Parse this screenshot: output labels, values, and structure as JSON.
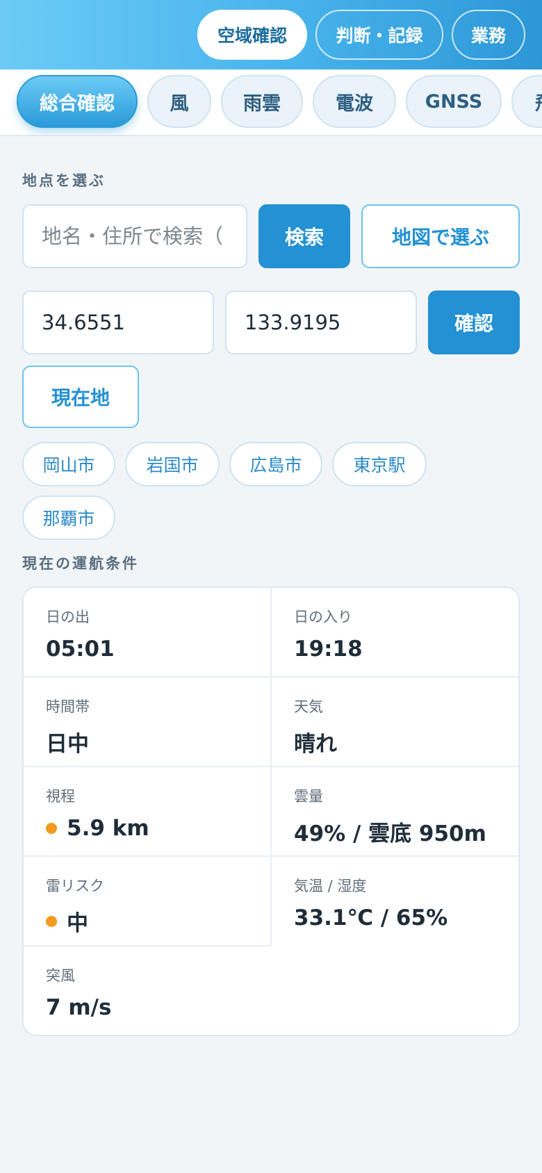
{
  "header": {
    "tabs": [
      {
        "label": "空域確認",
        "active": true
      },
      {
        "label": "判断・記録",
        "active": false
      },
      {
        "label": "業務",
        "active": false
      }
    ]
  },
  "subtabs": [
    {
      "label": "総合確認",
      "active": true
    },
    {
      "label": "風",
      "active": false
    },
    {
      "label": "雨雲",
      "active": false
    },
    {
      "label": "電波",
      "active": false
    },
    {
      "label": "GNSS",
      "active": false
    },
    {
      "label": "飛",
      "active": false
    }
  ],
  "location": {
    "section_label": "地点を選ぶ",
    "search_placeholder": "地名・住所で検索（",
    "search_button": "検索",
    "map_button": "地図で選ぶ",
    "latitude": "34.6551",
    "longitude": "133.9195",
    "confirm_button": "確認",
    "current_button": "現在地",
    "presets": [
      "岡山市",
      "岩国市",
      "広島市",
      "東京駅",
      "那覇市"
    ]
  },
  "conditions": {
    "section_label": "現在の運航条件",
    "sunrise": {
      "label": "日の出",
      "value": "05:01"
    },
    "sunset": {
      "label": "日の入り",
      "value": "19:18"
    },
    "time_of_day": {
      "label": "時間帯",
      "value": "日中"
    },
    "weather": {
      "label": "天気",
      "value": "晴れ"
    },
    "visibility": {
      "label": "視程",
      "value": "5.9 km",
      "status_color": "#f39a1e"
    },
    "cloud": {
      "label": "雲量",
      "value": "49% / 雲底 950m"
    },
    "thunder": {
      "label": "雷リスク",
      "value": "中",
      "status_color": "#f39a1e"
    },
    "temp_humidity": {
      "label": "気温 / 湿度",
      "value": "33.1℃ / 65%"
    },
    "gust": {
      "label": "突風",
      "value": "7 m/s"
    }
  },
  "colors": {
    "accent": "#2391d3",
    "header_gradient_start": "#6ccbf6",
    "header_gradient_end": "#2b97d6",
    "warning": "#f39a1e"
  }
}
